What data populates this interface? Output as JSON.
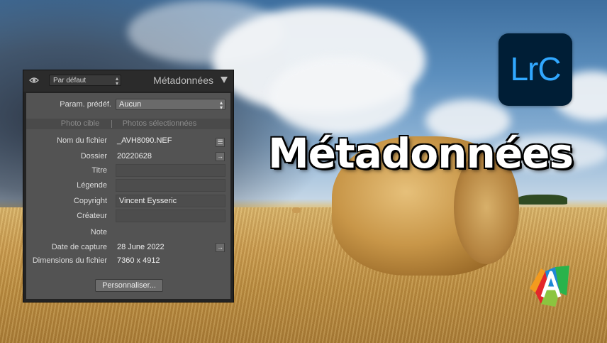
{
  "panel": {
    "preset_dropdown": "Par défaut",
    "title": "Métadonnées",
    "preset_label": "Param. prédéf.",
    "preset_value": "Aucun",
    "tabs": [
      "Photo cible",
      "Photos sélectionnées"
    ],
    "fields": [
      {
        "label": "Nom du fichier",
        "value": "_AVH8090.NEF"
      },
      {
        "label": "Dossier",
        "value": "20220628"
      },
      {
        "label": "Titre",
        "value": ""
      },
      {
        "label": "Légende",
        "value": ""
      },
      {
        "label": "Copyright",
        "value": "Vincent Eysseric"
      },
      {
        "label": "Créateur",
        "value": ""
      },
      {
        "label": "Note",
        "value": ""
      },
      {
        "label": "Date de capture",
        "value": "28 June 2022"
      },
      {
        "label": "Dimensions du fichier",
        "value": "7360 x 4912"
      }
    ],
    "customize_button": "Personnaliser..."
  },
  "overlay": {
    "app_logo_text": "LrC",
    "headline": "Métadonnées"
  },
  "icons": {
    "visibility": "eye-icon",
    "list": "list-icon",
    "go_to": "arrow-right-icon",
    "collapse": "triangle-down-icon"
  },
  "colors": {
    "panel_bg": "#535353",
    "header_bg": "#2b2b2b",
    "lrc_bg": "#001e36",
    "lrc_accent": "#31a8ff"
  }
}
